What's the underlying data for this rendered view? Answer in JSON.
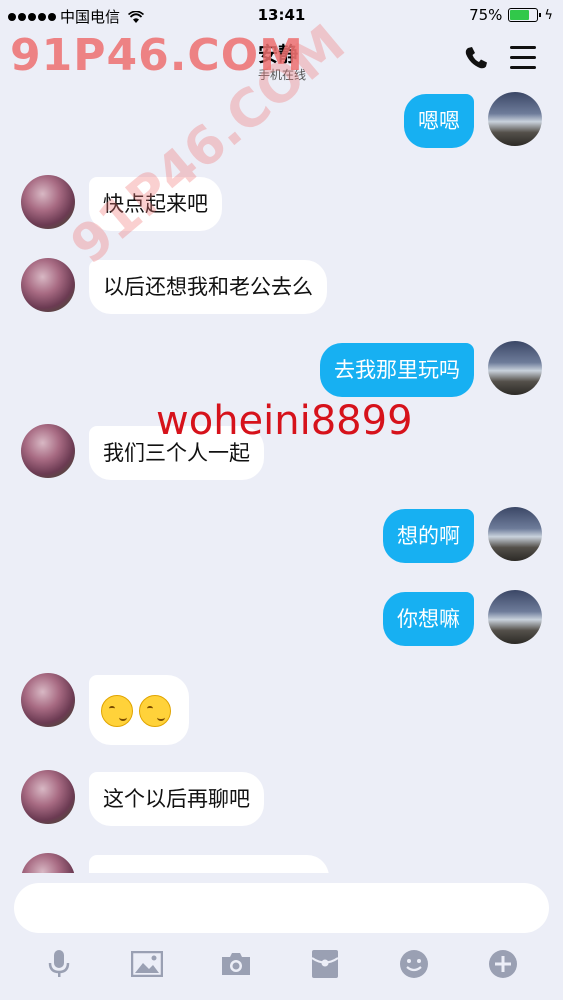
{
  "status_bar": {
    "carrier": "中国电信",
    "time": "13:41",
    "battery_percent": "75%",
    "battery_level": 0.75
  },
  "header": {
    "title": "安静",
    "subtitle": "手机在线"
  },
  "messages": [
    {
      "side": "out",
      "text": "嗯嗯"
    },
    {
      "side": "in",
      "text": "快点起来吧"
    },
    {
      "side": "in",
      "text": "以后还想我和老公去么"
    },
    {
      "side": "out",
      "text": "去我那里玩吗"
    },
    {
      "side": "in",
      "text": "我们三个人一起"
    },
    {
      "side": "out",
      "text": "想的啊"
    },
    {
      "side": "out",
      "text": "你想嘛"
    },
    {
      "side": "in",
      "text": "",
      "emoji": [
        "grin-emoji",
        "grin-emoji"
      ]
    },
    {
      "side": "in",
      "text": "这个以后再聊吧"
    }
  ],
  "watermarks": {
    "top_left": "91P46.COM",
    "diagonal": "91P46.COM",
    "center": "woheini8899"
  },
  "toolbar": [
    "microphone-icon",
    "image-icon",
    "camera-icon",
    "red-packet-icon",
    "emoji-icon",
    "plus-icon"
  ],
  "colors": {
    "outgoing_bubble": "#17b0f2",
    "incoming_bubble": "#ffffff",
    "background": "#eceef7"
  }
}
